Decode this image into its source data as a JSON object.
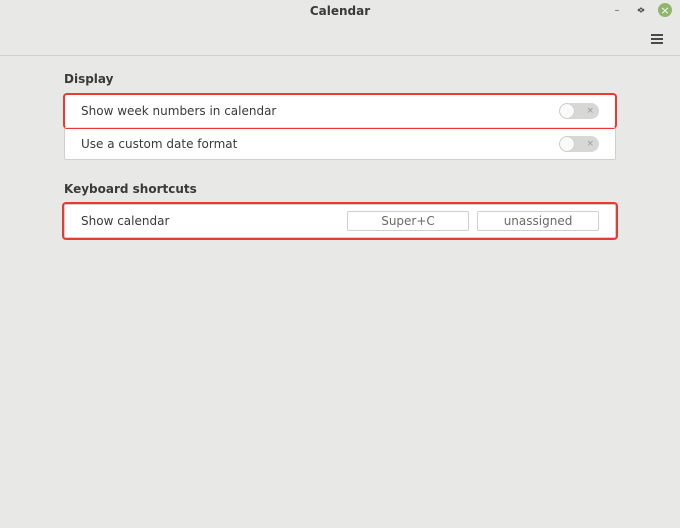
{
  "window": {
    "title": "Calendar"
  },
  "sections": {
    "display": {
      "title": "Display",
      "rows": [
        {
          "label": "Show week numbers in calendar",
          "value": false,
          "highlighted": true
        },
        {
          "label": "Use a custom date format",
          "value": false,
          "highlighted": false
        }
      ]
    },
    "keyboard": {
      "title": "Keyboard shortcuts",
      "rows": [
        {
          "label": "Show calendar",
          "binding1": "Super+C",
          "binding2": "unassigned",
          "highlighted": true
        }
      ]
    }
  }
}
